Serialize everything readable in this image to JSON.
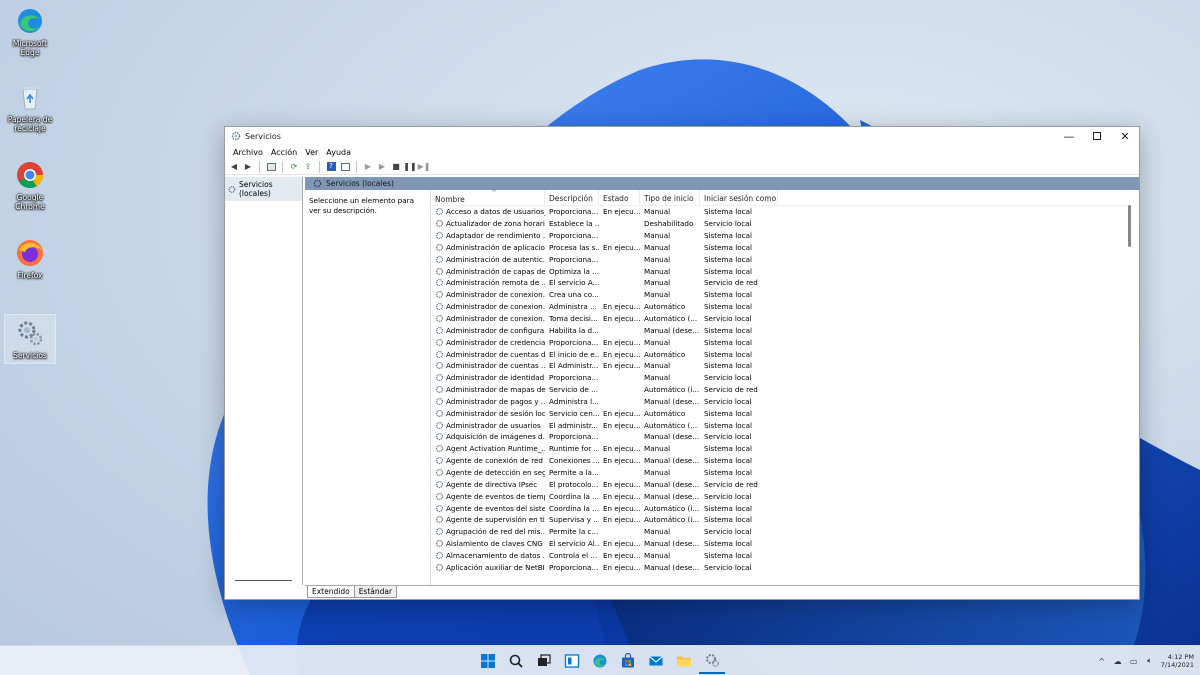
{
  "desktop": {
    "icons": [
      {
        "name": "edge",
        "label": "Microsoft Edge"
      },
      {
        "name": "recycle-bin",
        "label": "Papelera de reciclaje"
      },
      {
        "name": "chrome",
        "label": "Google Chrome"
      },
      {
        "name": "firefox",
        "label": "Firefox"
      },
      {
        "name": "services",
        "label": "Servicios"
      }
    ]
  },
  "window": {
    "title": "Servicios",
    "menu": [
      "Archivo",
      "Acción",
      "Ver",
      "Ayuda"
    ],
    "tree_item": "Servicios (locales)",
    "pane_title": "Servicios (locales)",
    "description_hint": "Seleccione un elemento para ver su descripción.",
    "columns": [
      "Nombre",
      "Descripción",
      "Estado",
      "Tipo de inicio",
      "Iniciar sesión como"
    ],
    "rows": [
      [
        "Acceso a datos de usuarios_...",
        "Proporciona...",
        "En ejecu...",
        "Manual",
        "Sistema local"
      ],
      [
        "Actualizador de zona horari...",
        "Establece la ...",
        "",
        "Deshabilitado",
        "Servicio local"
      ],
      [
        "Adaptador de rendimiento ...",
        "Proporciona...",
        "",
        "Manual",
        "Sistema local"
      ],
      [
        "Administración de aplicacio...",
        "Procesa las s...",
        "En ejecu...",
        "Manual",
        "Sistema local"
      ],
      [
        "Administración de autentic...",
        "Proporciona...",
        "",
        "Manual",
        "Sistema local"
      ],
      [
        "Administración de capas de...",
        "Optimiza la ...",
        "",
        "Manual",
        "Sistema local"
      ],
      [
        "Administración remota de ...",
        "El servicio A...",
        "",
        "Manual",
        "Servicio de red"
      ],
      [
        "Administrador de conexion...",
        "Crea una co...",
        "",
        "Manual",
        "Sistema local"
      ],
      [
        "Administrador de conexion...",
        "Administra ...",
        "En ejecu...",
        "Automático",
        "Sistema local"
      ],
      [
        "Administrador de conexion...",
        "Toma decisi...",
        "En ejecu...",
        "Automático (...",
        "Servicio local"
      ],
      [
        "Administrador de configura...",
        "Habilita la d...",
        "",
        "Manual (dese...",
        "Sistema local"
      ],
      [
        "Administrador de credencia...",
        "Proporciona...",
        "En ejecu...",
        "Manual",
        "Sistema local"
      ],
      [
        "Administrador de cuentas d...",
        "El inicio de e...",
        "En ejecu...",
        "Automático",
        "Sistema local"
      ],
      [
        "Administrador de cuentas ...",
        "El Administr...",
        "En ejecu...",
        "Manual",
        "Sistema local"
      ],
      [
        "Administrador de identidad...",
        "Proporciona...",
        "",
        "Manual",
        "Servicio local"
      ],
      [
        "Administrador de mapas de...",
        "Servicio de ...",
        "",
        "Automático (i...",
        "Servicio de red"
      ],
      [
        "Administrador de pagos y ...",
        "Administra l...",
        "",
        "Manual (dese...",
        "Servicio local"
      ],
      [
        "Administrador de sesión local",
        "Servicio cen...",
        "En ejecu...",
        "Automático",
        "Sistema local"
      ],
      [
        "Administrador de usuarios",
        "El administr...",
        "En ejecu...",
        "Automático (...",
        "Sistema local"
      ],
      [
        "Adquisición de imágenes d...",
        "Proporciona...",
        "",
        "Manual (dese...",
        "Servicio local"
      ],
      [
        "Agent Activation Runtime_...",
        "Runtime for ...",
        "En ejecu...",
        "Manual",
        "Sistema local"
      ],
      [
        "Agente de conexión de red",
        "Conexiones ...",
        "En ejecu...",
        "Manual (dese...",
        "Sistema local"
      ],
      [
        "Agente de detección en seg...",
        "Permite a la...",
        "",
        "Manual",
        "Sistema local"
      ],
      [
        "Agente de directiva IPsec",
        "El protocolo...",
        "En ejecu...",
        "Manual (dese...",
        "Servicio de red"
      ],
      [
        "Agente de eventos de tiempo",
        "Coordina la ...",
        "En ejecu...",
        "Manual (dese...",
        "Servicio local"
      ],
      [
        "Agente de eventos del siste...",
        "Coordina la ...",
        "En ejecu...",
        "Automático (i...",
        "Sistema local"
      ],
      [
        "Agente de supervisión en ti...",
        "Supervisa y ...",
        "En ejecu...",
        "Automático (i...",
        "Sistema local"
      ],
      [
        "Agrupación de red del mis...",
        "Permite la c...",
        "",
        "Manual",
        "Servicio local"
      ],
      [
        "Aislamiento de claves CNG",
        "El servicio Al...",
        "En ejecu...",
        "Manual (dese...",
        "Sistema local"
      ],
      [
        "Almacenamiento de datos ...",
        "Controla el ...",
        "En ejecu...",
        "Manual",
        "Sistema local"
      ],
      [
        "Aplicación auxiliar de NetBI...",
        "Proporciona...",
        "En ejecu...",
        "Manual (dese...",
        "Servicio local"
      ]
    ],
    "tabs": [
      "Extendido",
      "Estándar"
    ]
  },
  "taskbar": {
    "items": [
      "start",
      "search",
      "task-view",
      "widgets",
      "edge",
      "store",
      "mail",
      "file-explorer",
      "services"
    ]
  },
  "tray": {
    "time": "4:12 PM",
    "date": "7/14/2021"
  },
  "colors": {
    "accent": "#0067c0",
    "pane_header": "#7f97b5",
    "wallpaper_blue": "#1a5fd6"
  }
}
